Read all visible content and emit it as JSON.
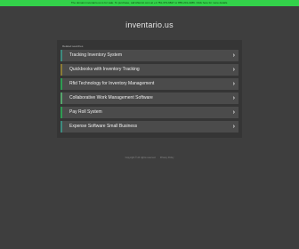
{
  "banner": {
    "text": "The domain inventario.us is for sale. To purchase, call Afternic.com at +1 781-373-6847 or 855-201-2286. Click here for more details."
  },
  "site": {
    "title": "inventario.us"
  },
  "panel": {
    "label": "Related searches",
    "items": [
      {
        "label": "Tracking Inventory System"
      },
      {
        "label": "Quickbooks with Inventory Tracking"
      },
      {
        "label": "Rfid Technology for Inventory Management"
      },
      {
        "label": "Collaborative Work Management Software"
      },
      {
        "label": "Pay Roll System"
      },
      {
        "label": "Expense Software Small Business"
      }
    ]
  },
  "footer": {
    "copyright": "Copyright © All rights reserved.",
    "privacy": "Privacy Policy"
  },
  "colors": {
    "background": "#3e3e3e",
    "banner": "#33d24a",
    "item_background": "#4b4b4b",
    "accent": "#2e9c52"
  },
  "icons": {
    "item_arrow": "chevron-right-icon"
  }
}
